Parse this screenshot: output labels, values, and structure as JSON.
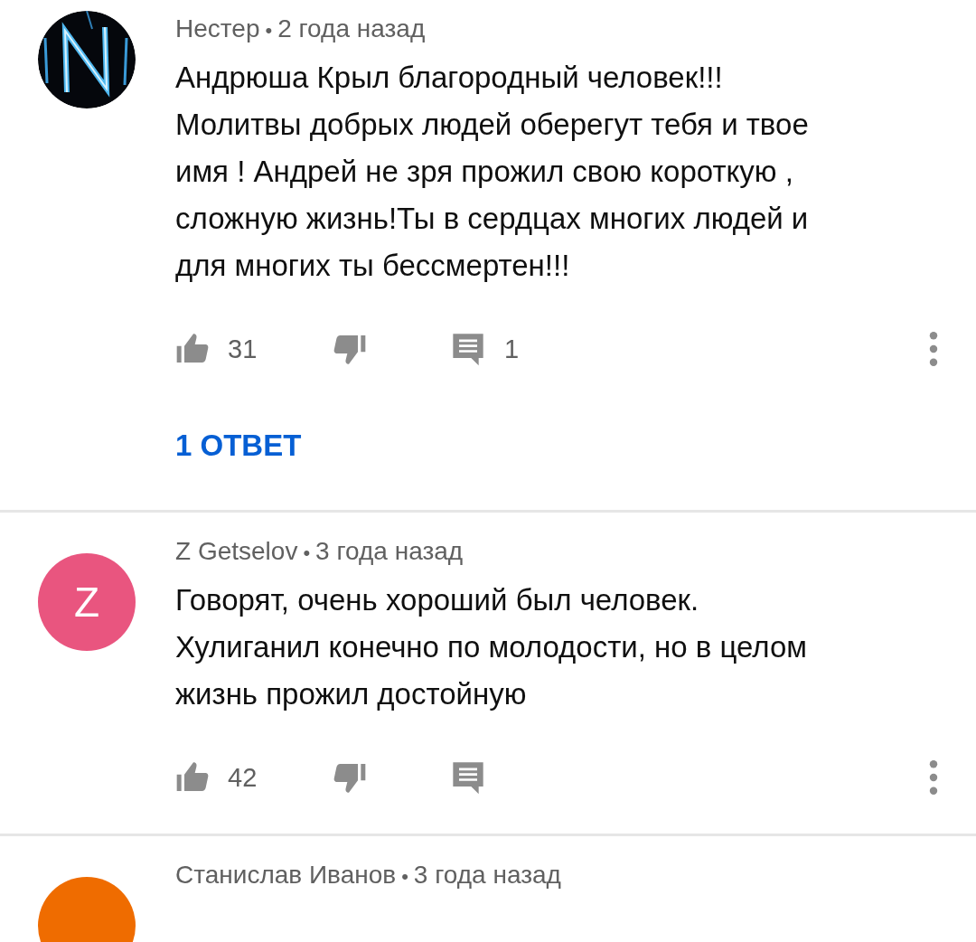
{
  "comments": [
    {
      "author": "Нестер",
      "separator": "•",
      "time": "2 года назад",
      "lines": [
        "Андрюша Крыл благородный человек!!!",
        "Молитвы добрых людей оберегут тебя и твое",
        "имя ! Андрей не зря прожил свою короткую ,",
        "сложную жизнь!Ты в сердцах многих людей и",
        "для многих ты бессмертен!!!"
      ],
      "likes": "31",
      "replies": "1",
      "reply_link": "1 ОТВЕТ"
    },
    {
      "author": "Z Getselov",
      "separator": "•",
      "time": "3 года назад",
      "avatar": {
        "kind": "letter",
        "letter": "Z",
        "color": "#e9557f"
      },
      "lines": [
        "Говорят, очень хороший был человек.",
        "Хулиганил конечно по молодости, но в целом",
        "жизнь прожил достойную"
      ],
      "likes": "42"
    },
    {
      "author": "Станислав Иванов",
      "separator": "•",
      "time": "3 года назад",
      "avatar": {
        "kind": "letter",
        "color": "#ef6c00"
      }
    }
  ]
}
